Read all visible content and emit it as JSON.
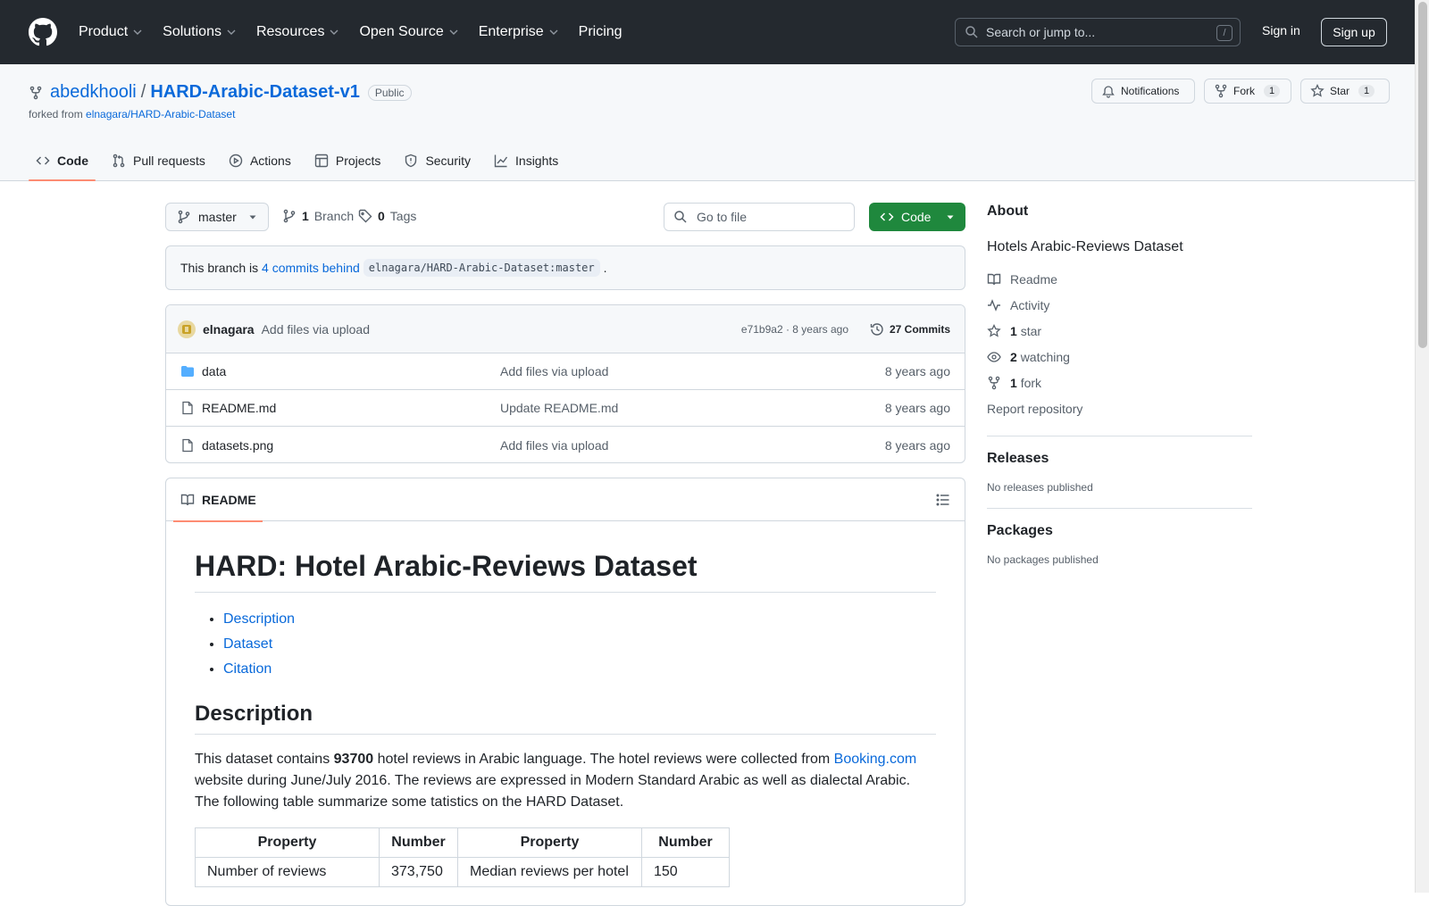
{
  "header": {
    "nav": [
      "Product",
      "Solutions",
      "Resources",
      "Open Source",
      "Enterprise",
      "Pricing"
    ],
    "search_placeholder": "Search or jump to...",
    "search_shortcut": "/",
    "sign_in": "Sign in",
    "sign_up": "Sign up"
  },
  "repo": {
    "owner": "abedkhooli",
    "separator": "/",
    "name": "HARD-Arabic-Dataset-v1",
    "visibility": "Public",
    "forked_from_label": "forked from",
    "forked_from": "elnagara/HARD-Arabic-Dataset",
    "notifications": "Notifications",
    "fork_label": "Fork",
    "fork_count": "1",
    "star_label": "Star",
    "star_count": "1"
  },
  "tabs": [
    "Code",
    "Pull requests",
    "Actions",
    "Projects",
    "Security",
    "Insights"
  ],
  "toolbar": {
    "branch": "master",
    "branch_count": "1",
    "branch_label": "Branch",
    "tag_count": "0",
    "tag_label": "Tags",
    "goto_file": "Go to file",
    "code_button": "Code"
  },
  "behind": {
    "prefix": "This branch is",
    "link": "4 commits behind",
    "ref": "elnagara/HARD-Arabic-Dataset:master",
    "suffix": "."
  },
  "commit": {
    "author": "elnagara",
    "message": "Add files via upload",
    "hash_age": "e71b9a2 · 8 years ago",
    "commits": "27 Commits"
  },
  "files": [
    {
      "name": "data",
      "type": "folder",
      "message": "Add files via upload",
      "age": "8 years ago"
    },
    {
      "name": "README.md",
      "type": "file",
      "message": "Update README.md",
      "age": "8 years ago"
    },
    {
      "name": "datasets.png",
      "type": "file",
      "message": "Add files via upload",
      "age": "8 years ago"
    }
  ],
  "readme": {
    "tab": "README",
    "title": "HARD: Hotel Arabic-Reviews Dataset",
    "toc": [
      "Description",
      "Dataset",
      "Citation"
    ],
    "desc_heading": "Description",
    "desc_1": "This dataset contains ",
    "desc_bold": "93700",
    "desc_2": " hotel reviews in Arabic language. The hotel reviews were collected from ",
    "desc_link": "Booking.com",
    "desc_3": " website during June/July 2016. The reviews are expressed in Modern Standard Arabic as well as dialectal Arabic. The following table summarize some tatistics on the HARD Dataset.",
    "table_headers": [
      "Property",
      "Number",
      "Property",
      "Number"
    ],
    "table_rows": [
      [
        "Number of reviews",
        "373,750",
        "Median reviews per hotel",
        "150"
      ]
    ]
  },
  "sidebar": {
    "about_heading": "About",
    "description": "Hotels Arabic-Reviews Dataset",
    "readme": "Readme",
    "activity": "Activity",
    "stars_count": "1",
    "stars_label": "star",
    "watching_count": "2",
    "watching_label": "watching",
    "forks_count": "1",
    "forks_label": "fork",
    "report": "Report repository",
    "releases_heading": "Releases",
    "releases_empty": "No releases published",
    "packages_heading": "Packages",
    "packages_empty": "No packages published"
  },
  "colors": {
    "header_bg": "#24292f",
    "accent_link": "#0969da",
    "code_button": "#1f883d",
    "tab_underline": "#fd8c73"
  }
}
